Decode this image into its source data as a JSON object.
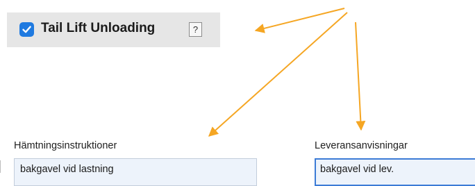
{
  "option": {
    "label": "Tail Lift Unloading",
    "checked": true,
    "help_label": "?"
  },
  "pickup": {
    "label": "Hämtningsinstruktioner",
    "value": "bakgavel vid lastning"
  },
  "delivery": {
    "label": "Leveransanvisningar",
    "value": "bakgavel vid lev."
  },
  "colors": {
    "arrow": "#f5a623",
    "checkbox": "#1f7ae0",
    "panel": "#e6e6e6",
    "field_bg": "#edf3fb"
  }
}
